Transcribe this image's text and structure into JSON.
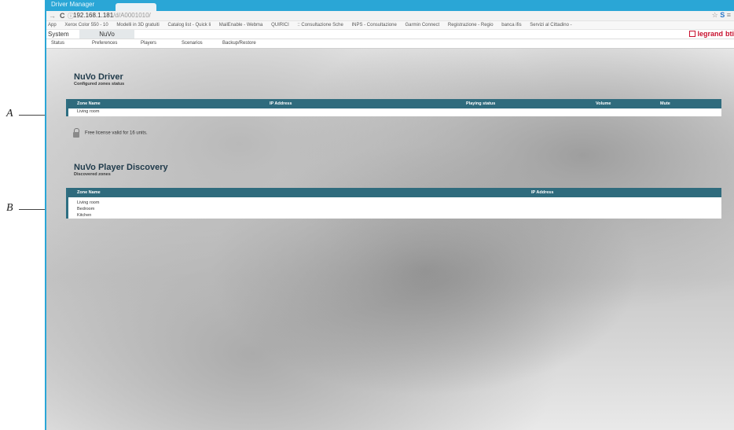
{
  "callouts": {
    "a": "A",
    "b": "B"
  },
  "browser": {
    "window_title": "Driver Manager",
    "url_host": "192.168.1.181",
    "url_path": "/d/A0001010/",
    "bookmarks": [
      "App",
      "Xerox Color 550 - 10",
      "Modelli in 3D gratuiti",
      "Catalog list - Quick li",
      "MailEnable - Webma",
      "QUIRICI",
      ":: Consultazione Sche",
      "INPS - Consultazione",
      "Garmin Connect",
      "Registrazione - Regio",
      "banca ifis",
      "Servizi al Cittadino -"
    ]
  },
  "app": {
    "system_label": "System",
    "active_tab": "NuVo",
    "brand": "legrand",
    "brand2": "bti",
    "submenu": [
      "Status",
      "Preferences",
      "Players",
      "Scenarios",
      "Backup/Restore"
    ]
  },
  "driver": {
    "title": "NuVo Driver",
    "subtitle": "Configured zones status",
    "columns": [
      "Zone Name",
      "IP Address",
      "Playing status",
      "Volume",
      "Mute"
    ],
    "rows": [
      "Living room"
    ],
    "license_text": "Free license valid for 16 units."
  },
  "discovery": {
    "title": "NuVo Player Discovery",
    "subtitle": "Discovered zones",
    "columns": [
      "Zone Name",
      "IP Address"
    ],
    "rows": [
      "Living room",
      "Bedroom",
      "Kitchen"
    ]
  },
  "colors": {
    "browser_accent": "#2aa6d6",
    "table_header": "#2f6b7d",
    "brand_red": "#c8102e"
  }
}
